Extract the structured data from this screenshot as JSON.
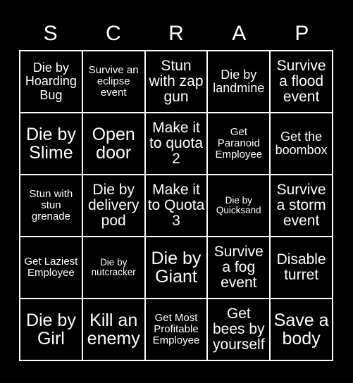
{
  "card": {
    "background_color": "#000000",
    "text_color": "#ffffff",
    "border_color": "#ffffff",
    "grid_size": "5x5"
  },
  "header": {
    "letters": [
      {
        "label": "S"
      },
      {
        "label": "C"
      },
      {
        "label": "R"
      },
      {
        "label": "A"
      },
      {
        "label": "P"
      }
    ]
  },
  "grid": {
    "cells": [
      {
        "text": "Die by Hoarding Bug",
        "size": "fs-md"
      },
      {
        "text": "Survive an eclipse event",
        "size": "fs-sm"
      },
      {
        "text": "Stun with zap gun",
        "size": "fs-lg"
      },
      {
        "text": "Die by landmine",
        "size": "fs-md"
      },
      {
        "text": "Survive a flood event",
        "size": "fs-lg"
      },
      {
        "text": "Die by Slime",
        "size": "fs-xl"
      },
      {
        "text": "Open door",
        "size": "fs-xl"
      },
      {
        "text": "Make it to quota 2",
        "size": "fs-lg"
      },
      {
        "text": "Get Paranoid Employee",
        "size": "fs-sm"
      },
      {
        "text": "Get the boombox",
        "size": "fs-md"
      },
      {
        "text": "Stun with stun grenade",
        "size": "fs-sm"
      },
      {
        "text": "Die by delivery pod",
        "size": "fs-lg"
      },
      {
        "text": "Make it to Quota 3",
        "size": "fs-lg"
      },
      {
        "text": "Die by Quicksand",
        "size": "fs-xs"
      },
      {
        "text": "Survive a storm event",
        "size": "fs-lg"
      },
      {
        "text": "Get Laziest Employee",
        "size": "fs-sm"
      },
      {
        "text": "Die by nutcracker",
        "size": "fs-xs"
      },
      {
        "text": "Die by Giant",
        "size": "fs-xl"
      },
      {
        "text": "Survive a fog event",
        "size": "fs-lg"
      },
      {
        "text": "Disable turret",
        "size": "fs-lg"
      },
      {
        "text": "Die by Girl",
        "size": "fs-xl"
      },
      {
        "text": "Kill an enemy",
        "size": "fs-xl"
      },
      {
        "text": "Get Most Profitable Employee",
        "size": "fs-sm"
      },
      {
        "text": "Get bees by yourself",
        "size": "fs-lg"
      },
      {
        "text": "Save a body",
        "size": "fs-xl"
      }
    ]
  }
}
